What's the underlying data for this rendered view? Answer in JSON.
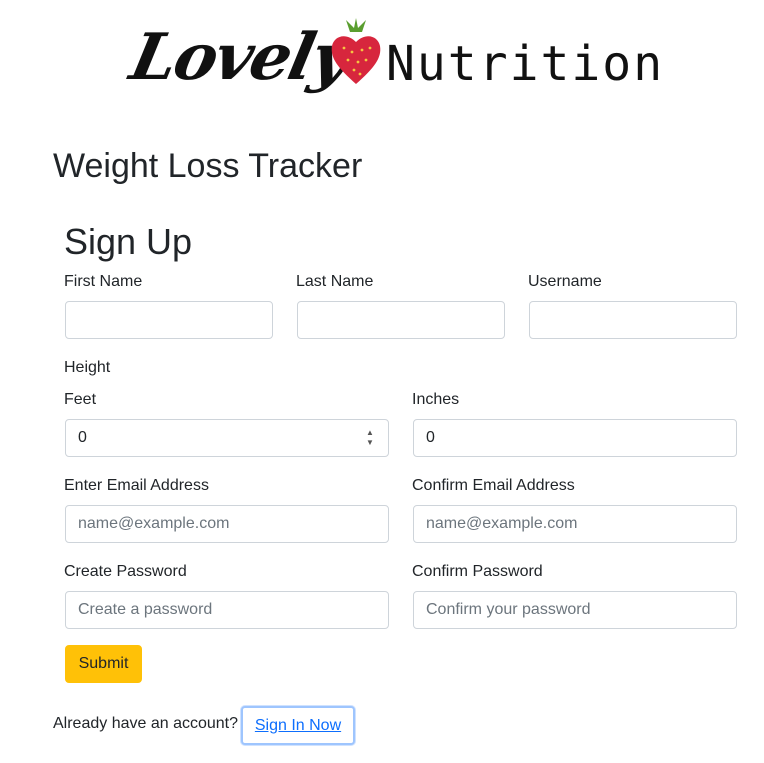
{
  "logo": {
    "script_text": "Lovely",
    "mono_text": "Nutrition",
    "brand_color": "#d7263d",
    "leaf_color": "#5a9e2f"
  },
  "page_title": "Weight Loss Tracker",
  "form": {
    "title": "Sign Up",
    "first_name": {
      "label": "First Name",
      "value": ""
    },
    "last_name": {
      "label": "Last Name",
      "value": ""
    },
    "username": {
      "label": "Username",
      "value": ""
    },
    "height_label": "Height",
    "feet": {
      "label": "Feet",
      "value": "0"
    },
    "inches": {
      "label": "Inches",
      "value": "0"
    },
    "email": {
      "label": "Enter Email Address",
      "placeholder": "name@example.com"
    },
    "confirm_email": {
      "label": "Confirm Email Address",
      "placeholder": "name@example.com"
    },
    "password": {
      "label": "Create Password",
      "placeholder": "Create a password"
    },
    "confirm_password": {
      "label": "Confirm Password",
      "placeholder": "Confirm your password"
    },
    "submit_label": "Submit"
  },
  "signin": {
    "prompt": "Already have an account?",
    "link_label": "Sign In Now"
  },
  "colors": {
    "submit": "#ffc107",
    "link": "#0d6efd",
    "focus_ring": "#9ec5fe"
  }
}
